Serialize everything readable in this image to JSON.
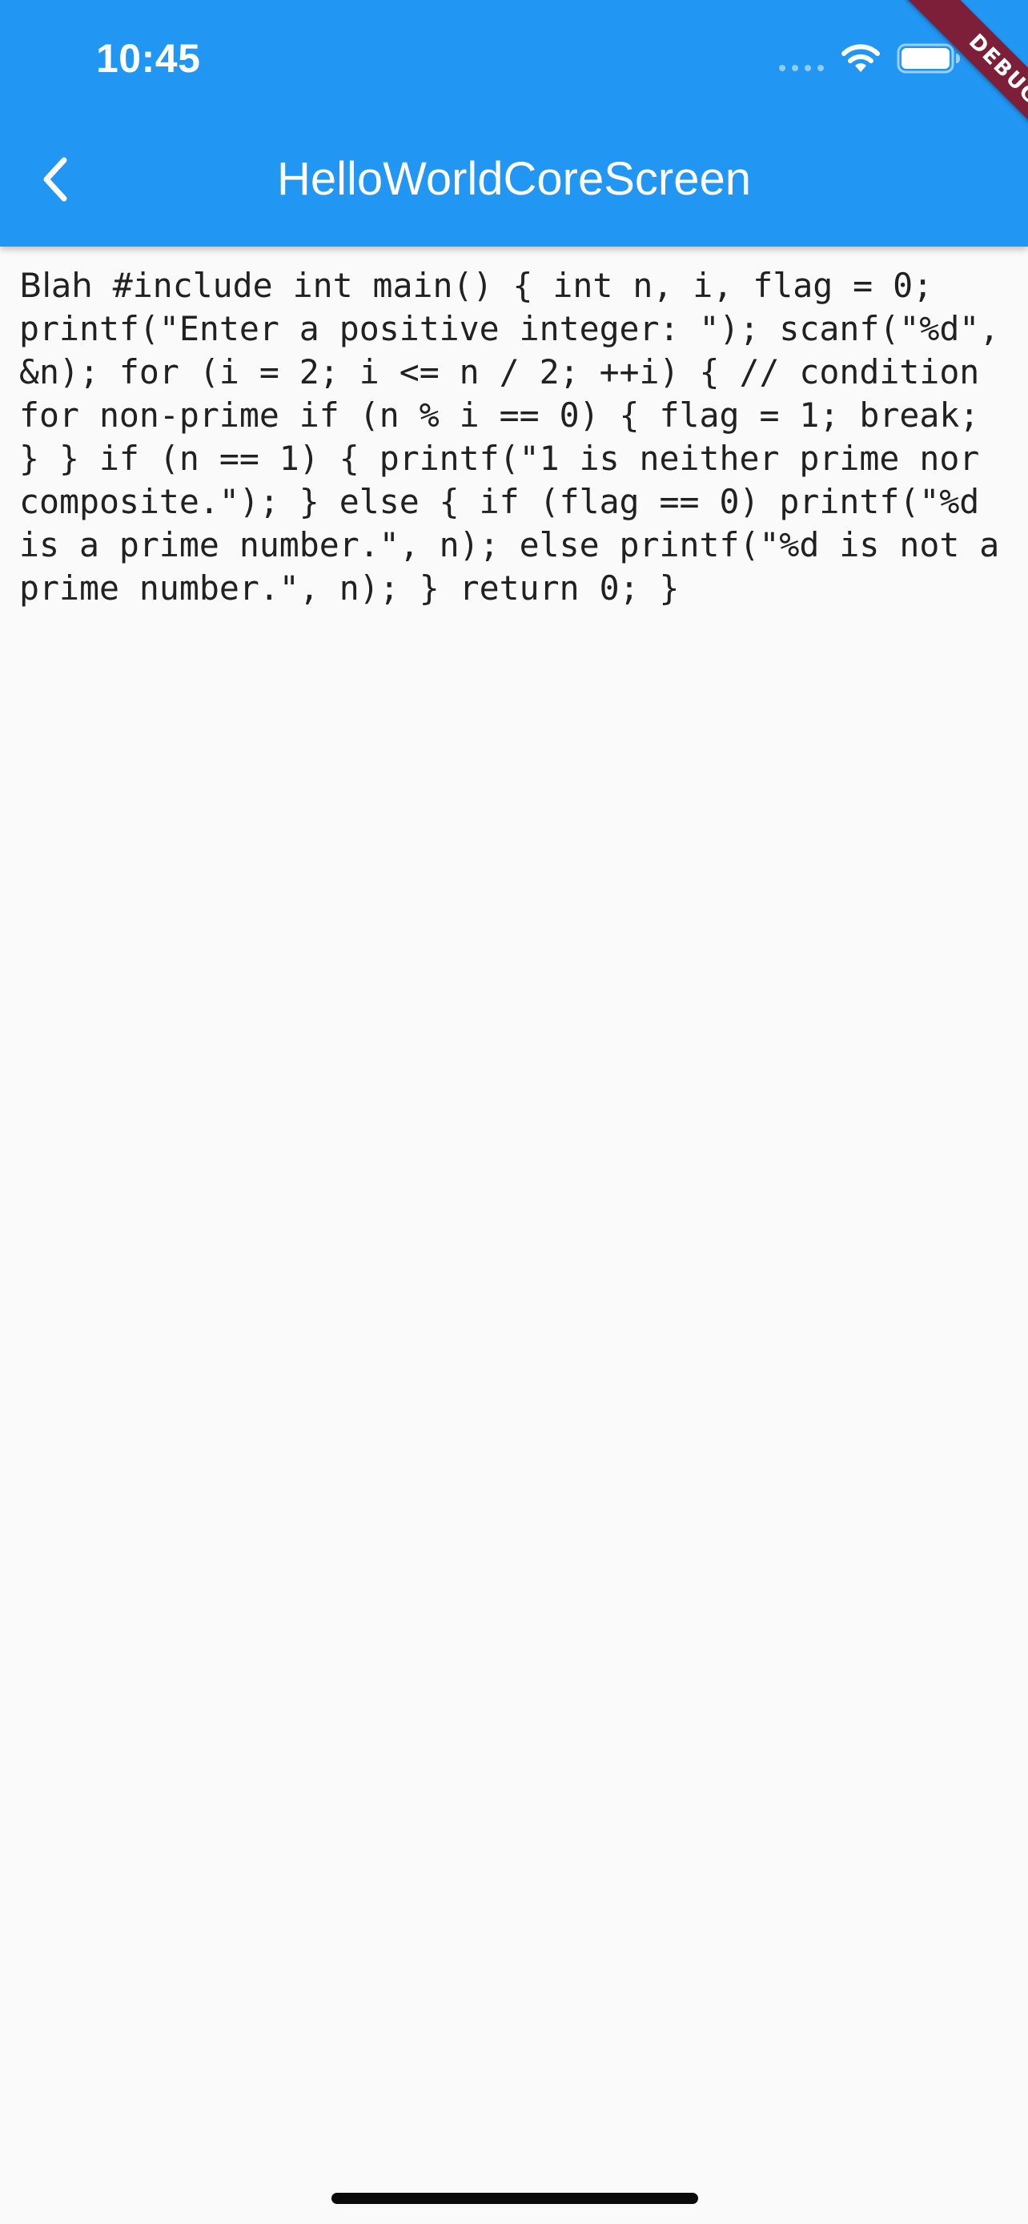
{
  "status_bar": {
    "time": "10:45"
  },
  "app_bar": {
    "title": "HelloWorldCoreScreen",
    "background_color": "#2196F3",
    "back_icon": "chevron-left-icon"
  },
  "debug_banner": {
    "label": "DEBUG",
    "color": "#7E1F3A"
  },
  "content": {
    "lead": "Blah",
    "code": "#include int main() { int n, i, flag = 0; printf(\"Enter a positive integer: \"); scanf(\"%d\", &n); for (i = 2; i <= n / 2; ++i) { // condition for non-prime if (n % i == 0) { flag = 1; break; } } if (n == 1) { printf(\"1 is neither prime nor composite.\"); } else { if (flag == 0) printf(\"%d is a prime number.\", n); else printf(\"%d is not a prime number.\", n); } return 0; }"
  }
}
